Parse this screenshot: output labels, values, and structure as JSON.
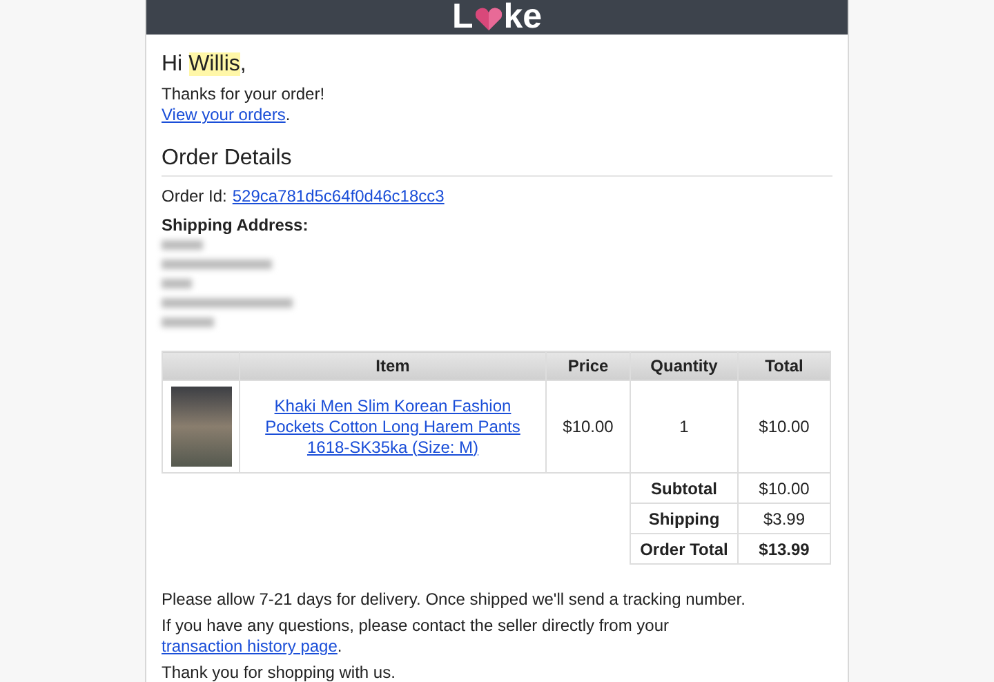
{
  "header": {
    "logo": {
      "before": "L",
      "after": "ke"
    }
  },
  "greeting": {
    "salutation": "Hi",
    "name": "Willis",
    "punctuation": ",",
    "name_highlighted": true
  },
  "thanks": "Thanks for your order!",
  "orders_link": {
    "text": "View your orders",
    "after": "."
  },
  "order_details": {
    "title": "Order Details",
    "order_id_label": "Order Id:",
    "order_id": "529ca781d5c64f0d46c18cc3",
    "shipping_label": "Shipping Address:"
  },
  "table": {
    "columns": [
      "",
      "Item",
      "Price",
      "Quantity",
      "Total"
    ],
    "rows": [
      {
        "item": "Khaki Men Slim Korean Fashion Pockets Cotton Long Harem Pants 1618-SK35ka (Size: M)",
        "price": "$10.00",
        "quantity": "1",
        "total": "$10.00"
      }
    ],
    "summary": [
      {
        "label": "Subtotal",
        "value": "$10.00",
        "emphasis": false
      },
      {
        "label": "Shipping",
        "value": "$3.99",
        "emphasis": false
      },
      {
        "label": "Order Total",
        "value": "$13.99",
        "emphasis": true
      }
    ]
  },
  "footer": {
    "delivery": "Please allow 7-21 days for delivery. Once shipped we'll send a tracking number.",
    "questions": "If you have any questions, please contact the seller directly from your",
    "questions_link": "transaction history page",
    "questions_after": ".",
    "closing": "Thank you for shopping with us."
  }
}
